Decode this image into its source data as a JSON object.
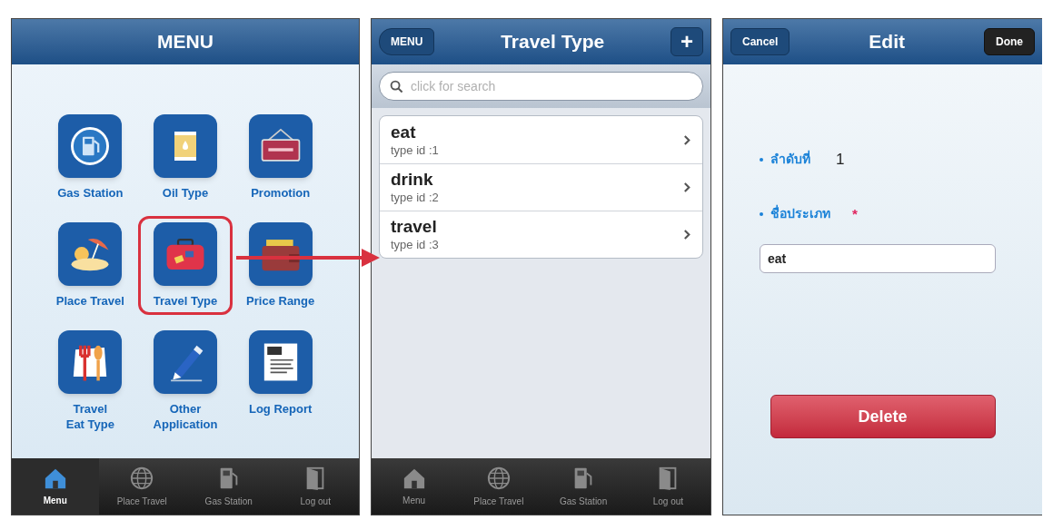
{
  "menu_screen": {
    "title": "MENU",
    "items": [
      {
        "label": "Gas Station",
        "selected": false
      },
      {
        "label": "Oil Type",
        "selected": false
      },
      {
        "label": "Promotion",
        "selected": false
      },
      {
        "label": "Place Travel",
        "selected": false
      },
      {
        "label": "Travel Type",
        "selected": true
      },
      {
        "label": "Price Range",
        "selected": false
      },
      {
        "label": "Travel\nEat Type",
        "selected": false
      },
      {
        "label": "Other\nApplication",
        "selected": false
      },
      {
        "label": "Log Report",
        "selected": false
      }
    ],
    "tab_bar": [
      {
        "label": "Menu",
        "selected": true
      },
      {
        "label": "Place Travel",
        "selected": false
      },
      {
        "label": "Gas Station",
        "selected": false
      },
      {
        "label": "Log out",
        "selected": false
      }
    ]
  },
  "list_screen": {
    "back_button": "MENU",
    "title": "Travel Type",
    "add_button": "+",
    "search": {
      "placeholder": "click for search"
    },
    "rows": [
      {
        "title": "eat",
        "subtitle": "type id :1"
      },
      {
        "title": "drink",
        "subtitle": "type id :2"
      },
      {
        "title": "travel",
        "subtitle": "type id :3"
      }
    ],
    "tab_bar": [
      {
        "label": "Menu",
        "selected": false
      },
      {
        "label": "Place Travel",
        "selected": false
      },
      {
        "label": "Gas Station",
        "selected": false
      },
      {
        "label": "Log out",
        "selected": false
      }
    ]
  },
  "edit_screen": {
    "cancel_button": "Cancel",
    "title": "Edit",
    "done_button": "Done",
    "fields": [
      {
        "kind": "text",
        "label": "ลำดับที่",
        "value": "1"
      },
      {
        "kind": "input",
        "label": "ชื่อประเภท",
        "required_mark": "*",
        "value": "eat"
      }
    ],
    "delete_button": "Delete"
  }
}
